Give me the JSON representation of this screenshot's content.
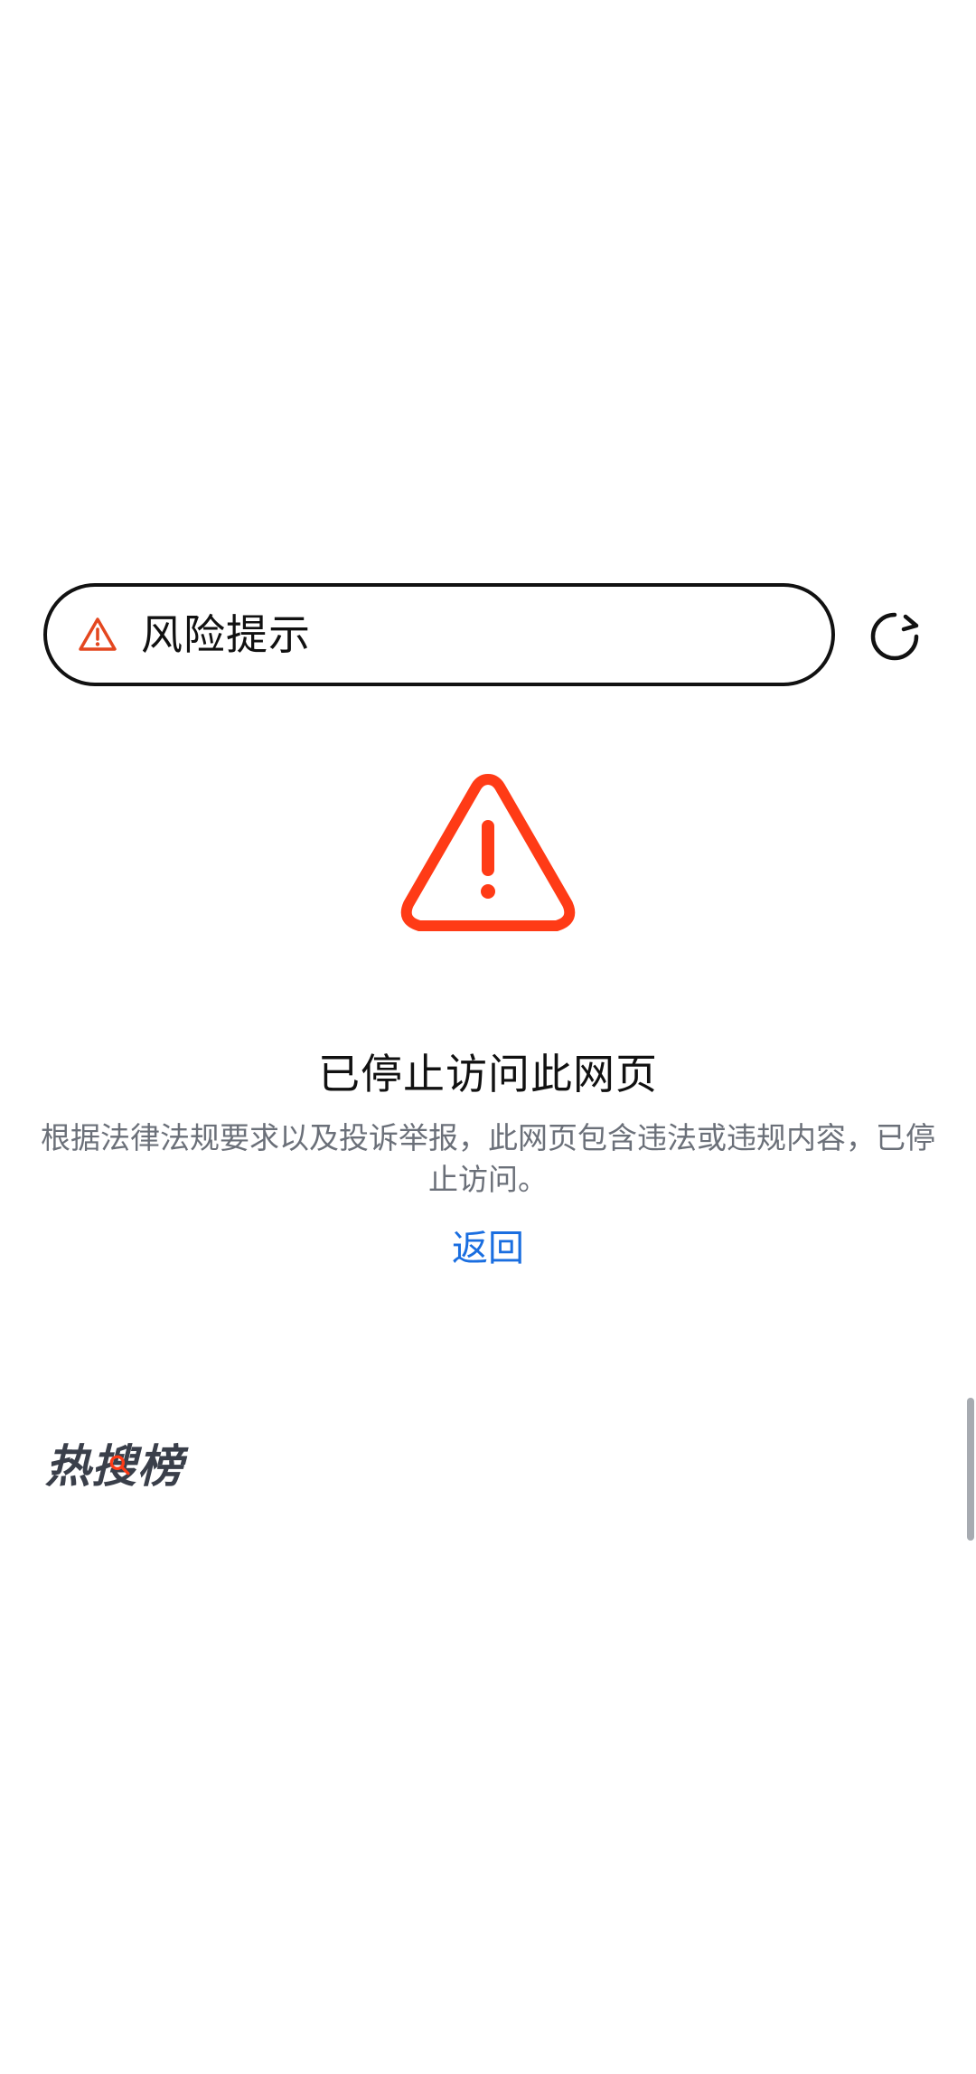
{
  "url_bar": {
    "title": "风险提示",
    "icon": "warning-triangle-icon",
    "icon_color": "#e4471f"
  },
  "reload": {
    "icon": "reload-icon"
  },
  "main": {
    "icon": "warning-triangle-icon",
    "icon_color": "#ff3b16",
    "title": "已停止访问此网页",
    "description": "根据法律法规要求以及投诉举报，此网页包含违法或违规内容，已停止访问。",
    "back_label": "返回",
    "link_color": "#1a6ee0"
  },
  "hot_search": {
    "title": "热搜榜",
    "accent_color": "#ff3b16"
  }
}
